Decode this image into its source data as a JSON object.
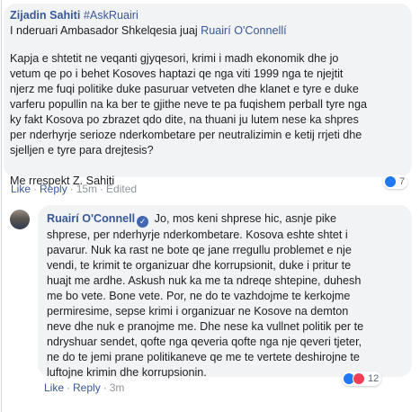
{
  "comment": {
    "author": "Zijadin Sahiti",
    "hashtag": "#AskRuairi",
    "greeting_prefix": "I nderuari Ambasador Shkelqesia juaj",
    "mention": "Ruairí O'Connellí",
    "paragraph1_lines": [
      "Kapja e shtetit ne veqanti gjyqesori, krimi i madh ekonomik dhe jo",
      "vetum qe po i behet Kosoves haptazi qe nga viti 1999 nga te njejtit",
      "njerz me fuqi politike duke pasuruar vetveten dhe klanet e tyre e duke",
      "varferu popullin na ka ber te gjithe neve te pa fuqishem perball tyre nga",
      "ky fakt Kosova po zbrazet qdo dite, na thuani ju lutem nese ka shpres",
      "per nderhyrje serioze nderkombetare per neutralizimin e ketij rrjeti dhe",
      "sjelljen e tyre para drejtesis?"
    ],
    "signoff": "Me rrespekt Z. Sahiti",
    "actions": {
      "like": "Like",
      "reply": "Reply",
      "time": "15m",
      "edited": "Edited",
      "sep": "·"
    },
    "reactions": {
      "count": "7"
    }
  },
  "reply": {
    "author": "Ruairí O'Connell",
    "verified_glyph": "✓",
    "first_line": "Jo, mos keni shprese hic, asnje pike",
    "lines": [
      "shprese, per nderhyrje nderkombetare. Kosova eshte shtet i",
      "pavarur. Nuk ka rast ne bote qe jane rregullu problemet e nje",
      "vendi, te krimit te organizuar dhe korrupsionit, duke i pritur te",
      "huajt me ardhe. Askush nuk ka me ta ndreqe shtepine, duhesh",
      "me bo vete. Bone vete. Por, ne do te vazhdojme te kerkojme",
      "permiresime, sepse krimi i organizuar ne Kosove na demton",
      "neve dhe nuk e pranojme me. Dhe nese ka vullnet politik per te",
      "ndryshuar sendet, qofte nga qeveria qofte nga nje qeveri tjeter,",
      "ne do te jemi prane politikaneve qe me te vertete deshirojne te",
      "luftojne krimin dhe korrupsionin."
    ],
    "actions": {
      "like": "Like",
      "reply": "Reply",
      "time": "3m",
      "sep": "·"
    },
    "reactions": {
      "count": "12"
    }
  },
  "icons": {
    "like": "like-reaction-icon",
    "love": "love-reaction-icon",
    "verified": "verified-badge-icon"
  },
  "colors": {
    "link": "#385898",
    "bubble": "#f2f3f5",
    "meta": "#90949c",
    "like": "#2078f4",
    "love": "#f33e58",
    "verified": "#4267b2"
  }
}
